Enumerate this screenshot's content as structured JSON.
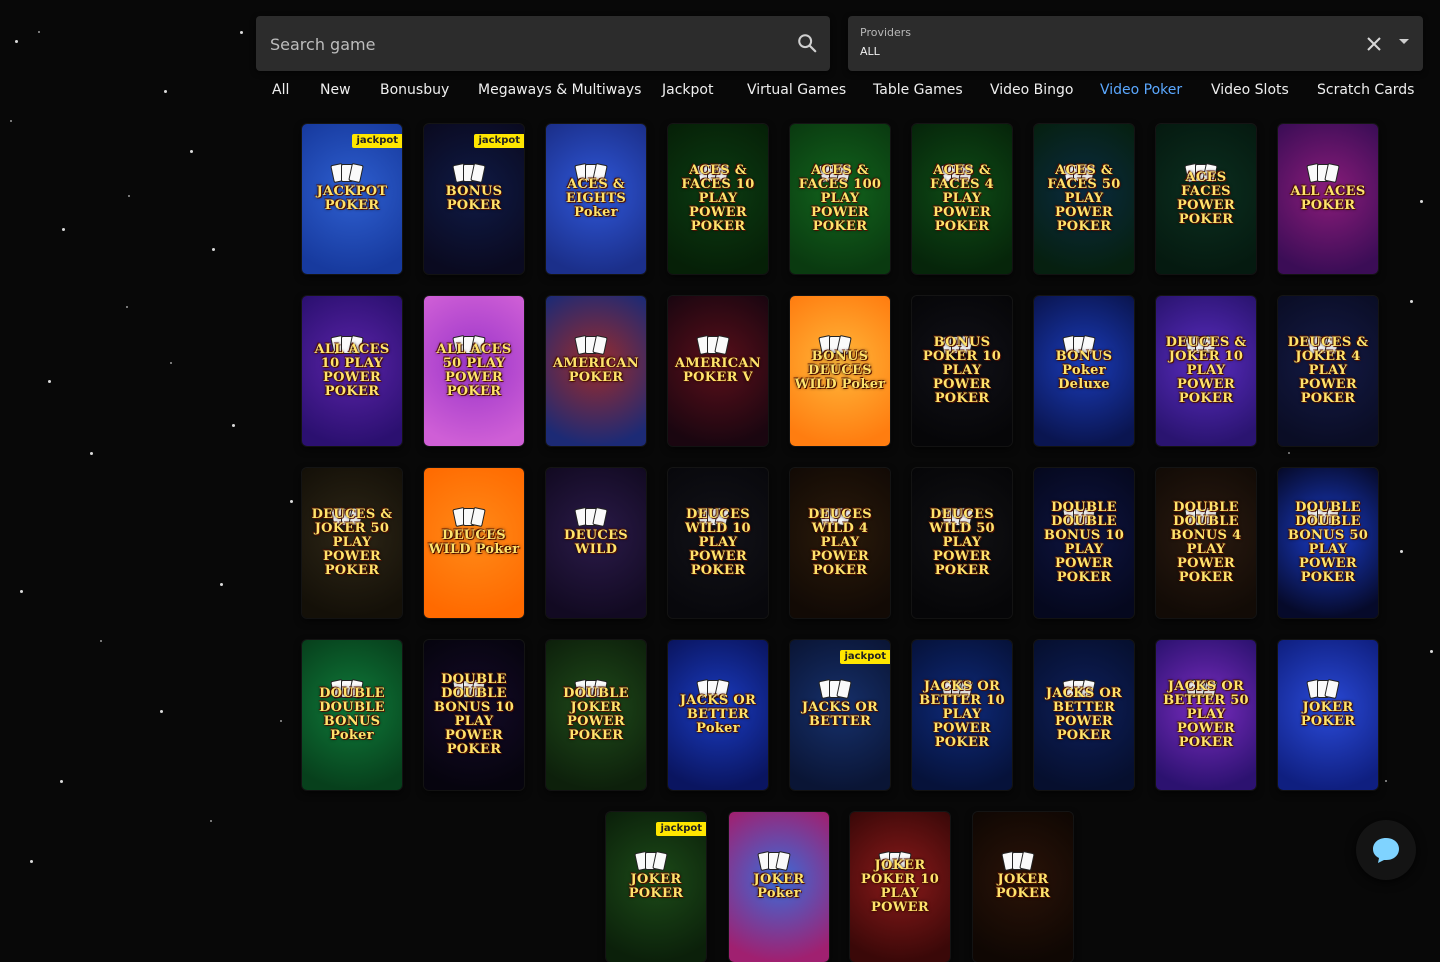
{
  "search": {
    "placeholder": "Search game",
    "value": ""
  },
  "providers": {
    "label": "Providers",
    "value": "ALL"
  },
  "tabs": [
    {
      "label": "All",
      "active": false
    },
    {
      "label": "New",
      "active": false
    },
    {
      "label": "Bonusbuy",
      "active": false
    },
    {
      "label": "Megaways & Multiways",
      "active": false
    },
    {
      "label": "Jackpot",
      "active": false
    },
    {
      "label": "Virtual Games",
      "active": false
    },
    {
      "label": "Table Games",
      "active": false
    },
    {
      "label": "Video Bingo",
      "active": false
    },
    {
      "label": "Video Poker",
      "active": true
    },
    {
      "label": "Video Slots",
      "active": false
    },
    {
      "label": "Scratch Cards",
      "active": false
    }
  ],
  "colors": {
    "accent": "#5ba8ff",
    "badge": "#ffe600",
    "background": "#080808",
    "panel": "#2c2c2c"
  },
  "games": [
    {
      "title": "JACKPOT POKER",
      "badge": "jackpot",
      "bg": [
        "#2e5fd0",
        "#173a9e"
      ]
    },
    {
      "title": "BONUS POKER",
      "badge": "jackpot",
      "bg": [
        "#0f1a45",
        "#0a0a20"
      ]
    },
    {
      "title": "ACES & EIGHTS Poker",
      "badge": "",
      "bg": [
        "#2f57d8",
        "#1b2f8a"
      ]
    },
    {
      "title": "ACES & FACES 10 PLAY POWER POKER",
      "badge": "",
      "bg": [
        "#0b3b12",
        "#062007"
      ]
    },
    {
      "title": "ACES & FACES 100 PLAY POWER POKER",
      "badge": "",
      "bg": [
        "#12641d",
        "#0a3a10"
      ]
    },
    {
      "title": "ACES & FACES 4 PLAY POWER POKER",
      "badge": "",
      "bg": [
        "#0e4b16",
        "#06250a"
      ]
    },
    {
      "title": "ACES & FACES 50 PLAY POWER POKER",
      "badge": "",
      "bg": [
        "#0a2a40",
        "#062010"
      ]
    },
    {
      "title": "ACES FACES POWER POKER",
      "badge": "",
      "bg": [
        "#0b2e1f",
        "#051a10"
      ]
    },
    {
      "title": "ALL ACES POKER",
      "badge": "",
      "bg": [
        "#8a1c7a",
        "#3b0d56"
      ]
    },
    {
      "title": "ALL ACES 10 PLAY POWER POKER",
      "badge": "",
      "bg": [
        "#5a23a8",
        "#2b1070"
      ]
    },
    {
      "title": "ALL ACES 50 PLAY POWER POKER",
      "badge": "",
      "bg": [
        "#9b35c9",
        "#cf5fd6"
      ]
    },
    {
      "title": "AMERICAN POKER",
      "badge": "",
      "bg": [
        "#9b2b2b",
        "#1c2a75"
      ]
    },
    {
      "title": "AMERICAN POKER V",
      "badge": "",
      "bg": [
        "#5a0f1a",
        "#1a0610"
      ]
    },
    {
      "title": "BONUS DEUCES WILD Poker",
      "badge": "",
      "bg": [
        "#ffb73a",
        "#ff7d10"
      ]
    },
    {
      "title": "BONUS POKER 10 PLAY POWER POKER",
      "badge": "",
      "bg": [
        "#111118",
        "#060608"
      ]
    },
    {
      "title": "BONUS Poker Deluxe",
      "badge": "",
      "bg": [
        "#1a3bb8",
        "#0a1550"
      ]
    },
    {
      "title": "DEUCES & JOKER 10 PLAY POWER POKER",
      "badge": "",
      "bg": [
        "#5a2cc0",
        "#2a1470"
      ]
    },
    {
      "title": "DEUCES & JOKER 4 PLAY POWER POKER",
      "badge": "",
      "bg": [
        "#141a45",
        "#0a0d25"
      ]
    },
    {
      "title": "DEUCES & JOKER 50 PLAY POWER POKER",
      "badge": "",
      "bg": [
        "#2d2616",
        "#141008"
      ]
    },
    {
      "title": "DEUCES WILD Poker",
      "badge": "",
      "bg": [
        "#ff8a18",
        "#ff6a00"
      ]
    },
    {
      "title": "DEUCES WILD",
      "badge": "",
      "bg": [
        "#2a1a48",
        "#120a22"
      ]
    },
    {
      "title": "DEUCES WILD 10 PLAY POWER POKER",
      "badge": "",
      "bg": [
        "#121218",
        "#08080c"
      ]
    },
    {
      "title": "DEUCES WILD 4 PLAY POWER POKER",
      "badge": "",
      "bg": [
        "#2a1a0a",
        "#120a05"
      ]
    },
    {
      "title": "DEUCES WILD 50 PLAY POWER POKER",
      "badge": "",
      "bg": [
        "#111114",
        "#060608"
      ]
    },
    {
      "title": "DOUBLE DOUBLE BONUS 10 PLAY POWER POKER",
      "badge": "",
      "bg": [
        "#0e1440",
        "#05081e"
      ]
    },
    {
      "title": "DOUBLE DOUBLE BONUS 4 PLAY POWER POKER",
      "badge": "",
      "bg": [
        "#2a1a10",
        "#120b06"
      ]
    },
    {
      "title": "DOUBLE DOUBLE BONUS 50 PLAY POWER POKER",
      "badge": "",
      "bg": [
        "#1a3dcc",
        "#060a2a"
      ]
    },
    {
      "title": "DOUBLE DOUBLE BONUS Poker",
      "badge": "",
      "bg": [
        "#0f7a3a",
        "#07401c"
      ]
    },
    {
      "title": "DOUBLE DOUBLE BONUS 10 PLAY POWER POKER",
      "badge": "",
      "bg": [
        "#140a28",
        "#06040e"
      ]
    },
    {
      "title": "DOUBLE JOKER POWER POKER",
      "badge": "",
      "bg": [
        "#1f4a1a",
        "#0d200b"
      ]
    },
    {
      "title": "JACKS OR BETTER Poker",
      "badge": "",
      "bg": [
        "#1a3bc0",
        "#0a1560"
      ]
    },
    {
      "title": "JACKS OR BETTER",
      "badge": "jackpot",
      "bg": [
        "#16306b",
        "#0a1535"
      ]
    },
    {
      "title": "JACKS OR BETTER 10 PLAY POWER POKER",
      "badge": "",
      "bg": [
        "#0e2a7a",
        "#06123a"
      ]
    },
    {
      "title": "JACKS OR BETTER POWER POKER",
      "badge": "",
      "bg": [
        "#0d1f5a",
        "#060f2e"
      ]
    },
    {
      "title": "JACKS OR BETTER 50 PLAY POWER POKER",
      "badge": "",
      "bg": [
        "#7a2cc0",
        "#2c1270"
      ]
    },
    {
      "title": "JOKER POKER",
      "badge": "",
      "bg": [
        "#2a4ad8",
        "#0f1f80"
      ]
    },
    {
      "title": "JOKER POKER",
      "badge": "jackpot",
      "bg": [
        "#1c4a18",
        "#0b200a"
      ]
    },
    {
      "title": "JOKER Poker",
      "badge": "",
      "bg": [
        "#3b6bd8",
        "#a02070"
      ]
    },
    {
      "title": "JOKER POKER 10 PLAY POWER",
      "badge": "",
      "bg": [
        "#8a1a1a",
        "#3a0808"
      ]
    },
    {
      "title": "JOKER POKER",
      "badge": "",
      "bg": [
        "#2a1308",
        "#0f0703"
      ]
    }
  ]
}
